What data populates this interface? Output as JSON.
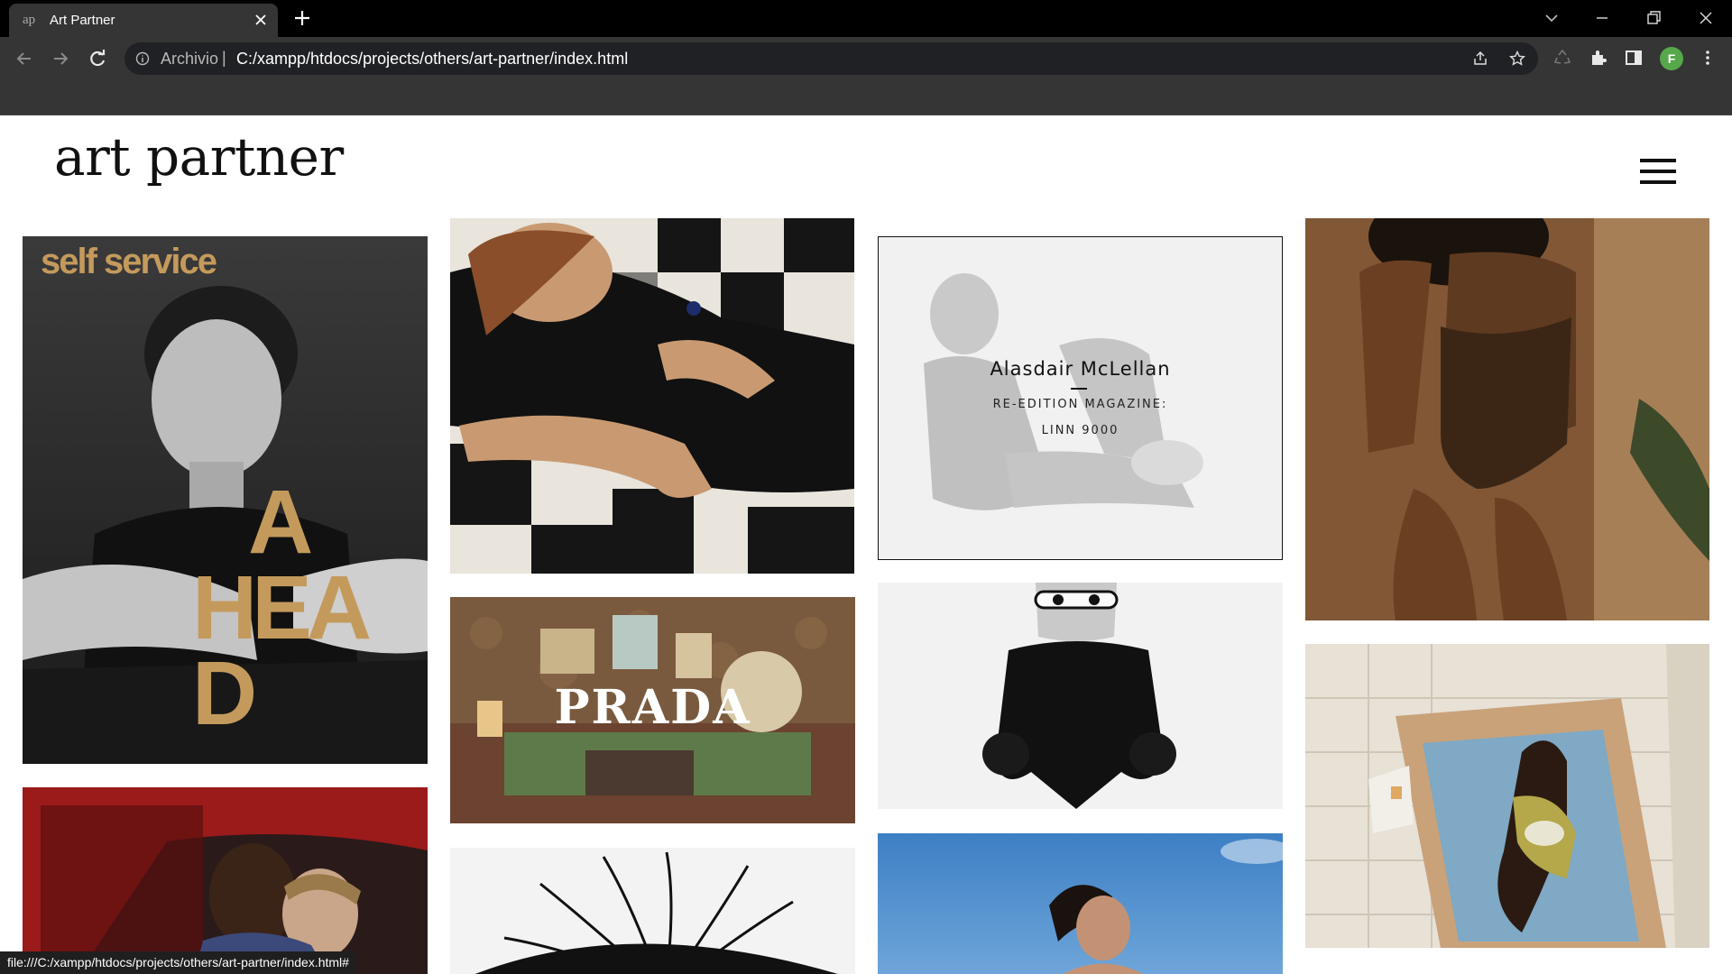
{
  "browser": {
    "tab_title": "Art Partner",
    "tab_favicon": "ap",
    "url_prefix": "Archivio",
    "url": "C:/xampp/htdocs/projects/others/art-partner/index.html",
    "profile_initial": "F",
    "status_url": "file:///C:/xampp/htdocs/projects/others/art-partner/index.html#"
  },
  "site": {
    "logo": "art partner"
  },
  "tiles": {
    "self_service": {
      "masthead": "self service",
      "headline_1": "A",
      "headline_2": "HEA",
      "headline_3": "D"
    },
    "prada": {
      "text": "PRADA"
    },
    "mclellan": {
      "name": "Alasdair McLellan",
      "line1": "RE-EDITION MAGAZINE:",
      "line2": "LINN 9000"
    }
  },
  "colors": {
    "chrome_bg": "#000000",
    "toolbar_bg": "#353535",
    "omnibox_bg": "#202124",
    "accent_gold": "#c49a5c",
    "profile_green": "#56a84a"
  }
}
